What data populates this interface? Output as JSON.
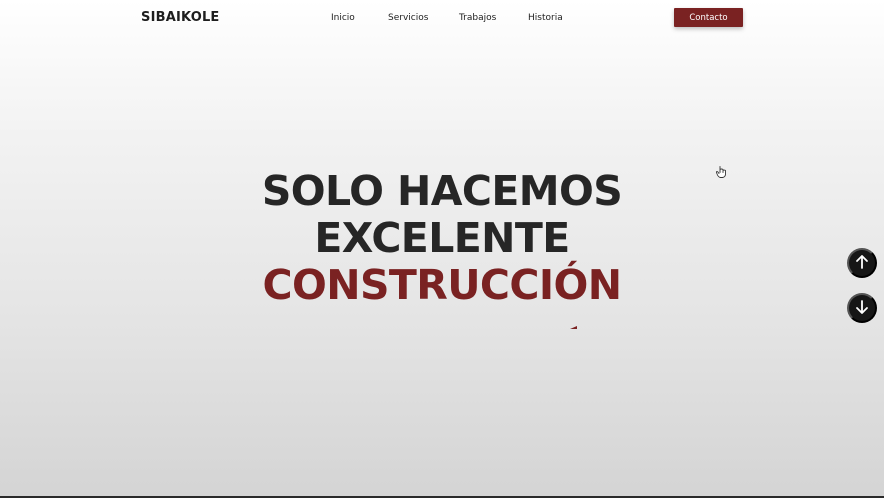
{
  "header": {
    "logo": "SIBAIKOLE",
    "nav": [
      {
        "label": "Inicio"
      },
      {
        "label": "Servicios"
      },
      {
        "label": "Trabajos"
      },
      {
        "label": "Historia"
      }
    ],
    "contact_label": "Contacto"
  },
  "hero": {
    "line1": "SOLO HACEMOS",
    "line2": "EXCELENTE",
    "line3": "CONSTRUCCIÓN"
  },
  "icons": {
    "cursor": "hand-pointer-icon",
    "scroll_up": "arrow-up-icon",
    "scroll_down": "arrow-down-icon"
  },
  "colors": {
    "accent": "#7a2222",
    "text": "#262626",
    "scroll_button": "#161616"
  }
}
